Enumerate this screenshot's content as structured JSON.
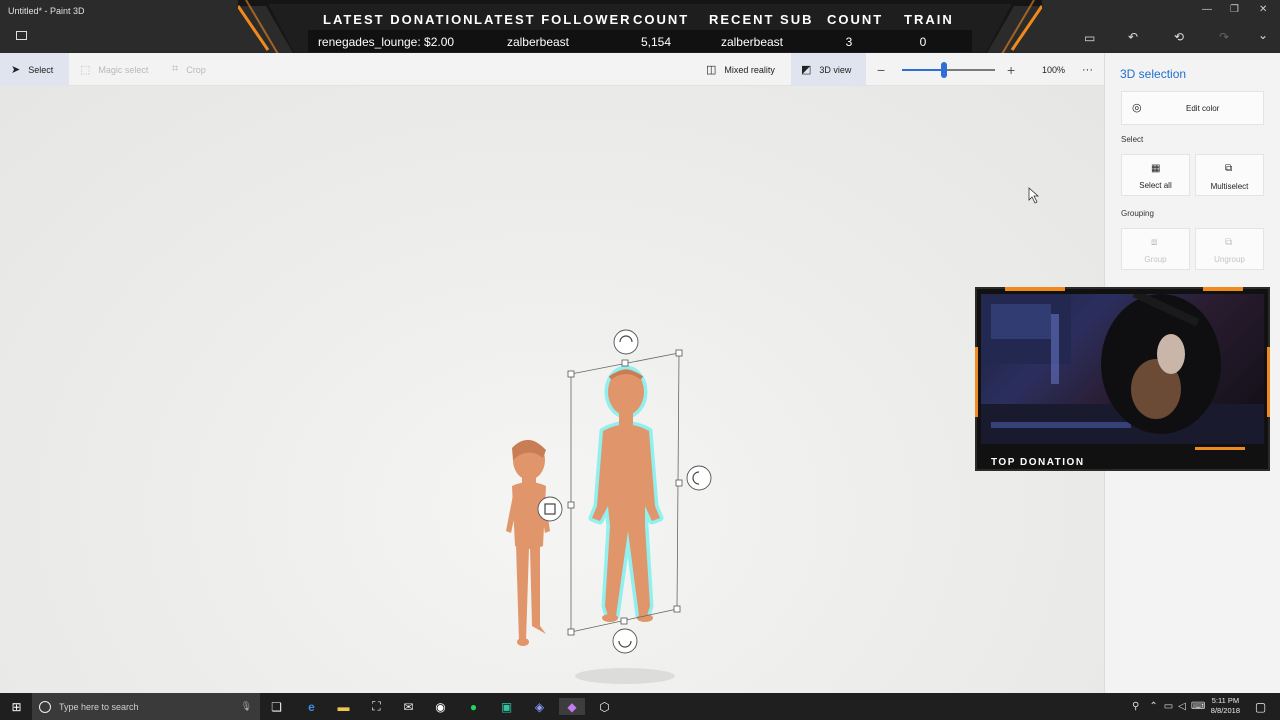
{
  "window": {
    "title": "Untitled* - Paint 3D"
  },
  "banner": {
    "headers": [
      "LATEST DONATION",
      "LATEST FOLLOWER",
      "COUNT",
      "RECENT SUB",
      "COUNT",
      "TRAIN"
    ],
    "values": [
      "renegades_lounge: $2.00",
      "zalberbeast",
      "5,154",
      "zalberbeast",
      "3",
      "0"
    ],
    "accent": "#f08a1c"
  },
  "toolbar": {
    "select": "Select",
    "magic_select": "Magic select",
    "crop": "Crop",
    "mixed_reality": "Mixed reality",
    "view_3d": "3D view",
    "zoom_minus": "−",
    "zoom_plus": "+",
    "zoom_level": "100%",
    "zoom_fraction": 0.45,
    "more": "···"
  },
  "panel": {
    "title": "3D selection",
    "edit_color": "Edit color",
    "select_section": "Select",
    "select_all": "Select all",
    "multiselect": "Multiselect",
    "grouping_section": "Grouping",
    "group": "Group",
    "ungroup": "Ungroup"
  },
  "webcam": {
    "label": "TOP DONATION"
  },
  "taskbar": {
    "search_placeholder": "Type here to search",
    "time": "5:11 PM",
    "date": "8/8/2018"
  },
  "colors": {
    "accent_blue": "#1f6fd1",
    "figure": "#e0966a",
    "highlight": "#7ff0f0"
  }
}
